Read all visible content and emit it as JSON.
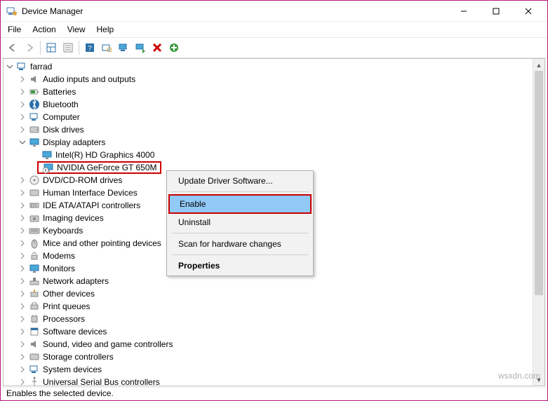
{
  "app": {
    "title": "Device Manager"
  },
  "menu": {
    "file": "File",
    "action": "Action",
    "view": "View",
    "help": "Help"
  },
  "tree": {
    "root": "farrad",
    "items": [
      "Audio inputs and outputs",
      "Batteries",
      "Bluetooth",
      "Computer",
      "Disk drives",
      "Display adapters",
      "DVD/CD-ROM drives",
      "Human Interface Devices",
      "IDE ATA/ATAPI controllers",
      "Imaging devices",
      "Keyboards",
      "Mice and other pointing devices",
      "Modems",
      "Monitors",
      "Network adapters",
      "Other devices",
      "Print queues",
      "Processors",
      "Software devices",
      "Sound, video and game controllers",
      "Storage controllers",
      "System devices",
      "Universal Serial Bus controllers"
    ],
    "display_children": {
      "intel": "Intel(R) HD Graphics 4000",
      "nvidia": "NVIDIA GeForce GT 650M"
    }
  },
  "context_menu": {
    "update": "Update Driver Software...",
    "enable": "Enable",
    "uninstall": "Uninstall",
    "scan": "Scan for hardware changes",
    "properties": "Properties"
  },
  "status": "Enables the selected device.",
  "watermark": "wsxdn.com"
}
